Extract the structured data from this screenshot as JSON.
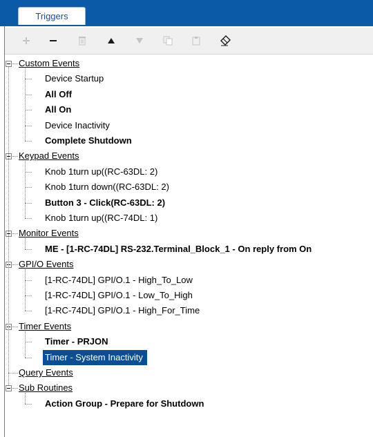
{
  "tab": {
    "label": "Triggers"
  },
  "toolbar": {
    "buttons": [
      {
        "name": "add",
        "enabled": false
      },
      {
        "name": "remove",
        "enabled": true
      },
      {
        "name": "delete",
        "enabled": false
      },
      {
        "name": "move-up",
        "enabled": true
      },
      {
        "name": "move-down",
        "enabled": false
      },
      {
        "name": "copy",
        "enabled": false
      },
      {
        "name": "paste",
        "enabled": false
      },
      {
        "name": "rename",
        "enabled": true
      }
    ]
  },
  "tree": {
    "groups": [
      {
        "label": "Custom Events",
        "items": [
          {
            "label": "Device Startup",
            "bold": false
          },
          {
            "label": "All Off",
            "bold": true
          },
          {
            "label": "All On",
            "bold": true
          },
          {
            "label": "Device Inactivity",
            "bold": false
          },
          {
            "label": "Complete Shutdown",
            "bold": true
          }
        ]
      },
      {
        "label": "Keypad Events",
        "items": [
          {
            "label": "Knob 1turn up((RC-63DL: 2)",
            "bold": false
          },
          {
            "label": "Knob 1turn down((RC-63DL: 2)",
            "bold": false
          },
          {
            "label": "Button 3 - Click(RC-63DL: 2)",
            "bold": true
          },
          {
            "label": "Knob 1turn up((RC-74DL: 1)",
            "bold": false
          }
        ]
      },
      {
        "label": "Monitor Events",
        "items": [
          {
            "label": "ME - [1-RC-74DL] RS-232.Terminal_Block_1 - On reply from On",
            "bold": true
          }
        ]
      },
      {
        "label": "GPI/O Events",
        "items": [
          {
            "label": "[1-RC-74DL] GPI/O.1 - High_To_Low",
            "bold": false
          },
          {
            "label": "[1-RC-74DL] GPI/O.1 - Low_To_High",
            "bold": false
          },
          {
            "label": "[1-RC-74DL] GPI/O.1 - High_For_Time",
            "bold": false
          }
        ]
      },
      {
        "label": "Timer Events",
        "items": [
          {
            "label": "Timer - PRJON",
            "bold": true
          },
          {
            "label": "Timer - System Inactivity",
            "bold": false,
            "selected": true
          }
        ]
      },
      {
        "label": "Query Events",
        "items": []
      },
      {
        "label": "Sub Routines",
        "items": [
          {
            "label": "Action Group - Prepare for Shutdown",
            "bold": true
          }
        ]
      }
    ]
  },
  "colors": {
    "tab_bar": "#0a5aa8",
    "selection": "#0a4f96",
    "toolbar_bg": "#f0f0f0"
  }
}
